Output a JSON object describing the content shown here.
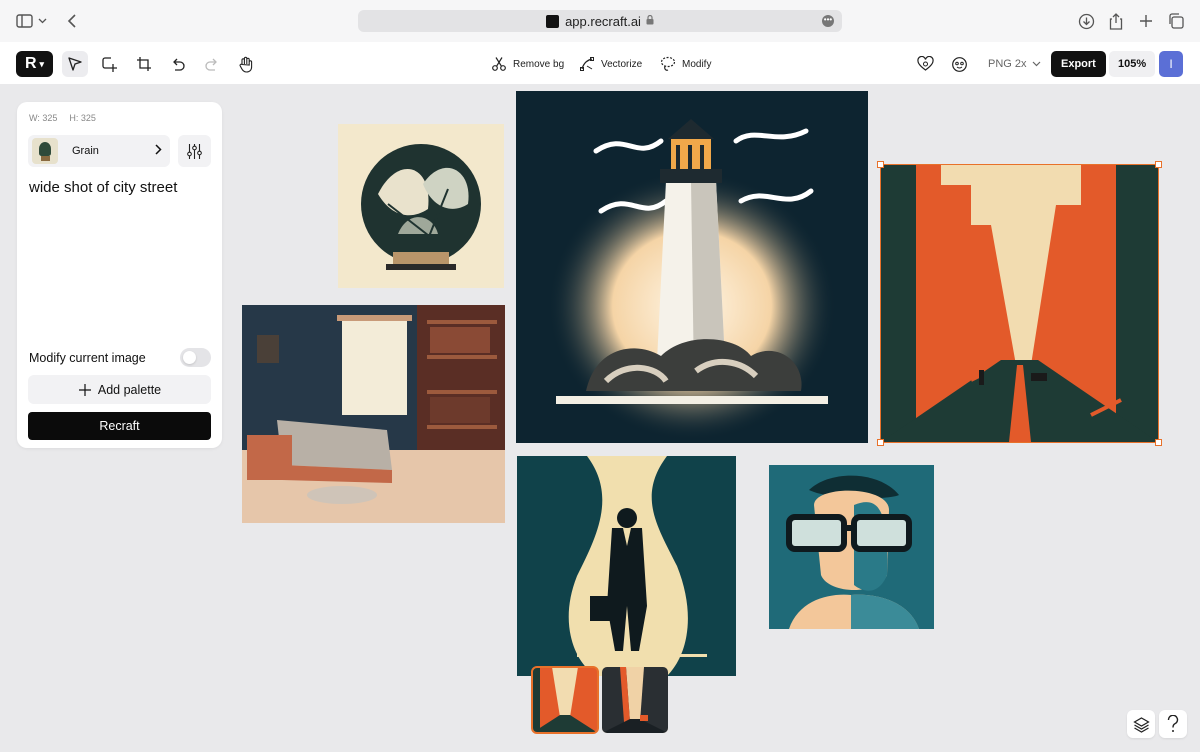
{
  "browser": {
    "url": "app.recraft.ai",
    "icons": [
      "sidebar-icon",
      "chevron-down-icon",
      "back-icon",
      "download-icon",
      "share-icon",
      "new-tab-icon",
      "tabs-icon"
    ]
  },
  "toolbar": {
    "brand_letter": "R",
    "actions": {
      "remove_bg": "Remove bg",
      "vectorize": "Vectorize",
      "modify": "Modify"
    },
    "format": "PNG 2x",
    "export_label": "Export",
    "zoom": "105%",
    "avatar_initial": "I"
  },
  "panel": {
    "width_label": "W: 325",
    "height_label": "H: 325",
    "style_name": "Grain",
    "prompt": "wide shot of city street",
    "modify_label": "Modify current image",
    "modify_enabled": false,
    "add_palette_label": "Add palette",
    "recraft_label": "Recraft"
  },
  "canvas": {
    "images": [
      {
        "name": "plant-image",
        "subject": "potted plant in circle"
      },
      {
        "name": "lighthouse-image",
        "subject": "lighthouse on rocks"
      },
      {
        "name": "city-street-image",
        "subject": "city street, selected"
      },
      {
        "name": "bedroom-image",
        "subject": "bedroom with bookshelves"
      },
      {
        "name": "businessman-image",
        "subject": "man with briefcase"
      },
      {
        "name": "glasses-portrait-image",
        "subject": "man with glasses"
      }
    ],
    "variant_thumbnails": 2,
    "selected_variant": 1
  },
  "colors": {
    "accent": "#e8712a",
    "avatar": "#5b6fd6",
    "canvas_bg": "#e9e9eb"
  }
}
